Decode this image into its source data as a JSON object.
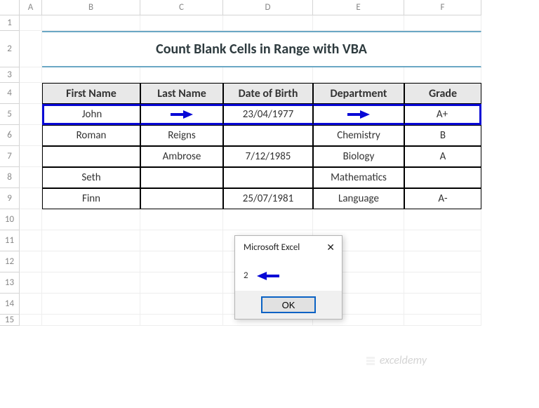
{
  "columns": [
    "A",
    "B",
    "C",
    "D",
    "E",
    "F"
  ],
  "rows": [
    "1",
    "2",
    "3",
    "4",
    "5",
    "6",
    "7",
    "8",
    "9",
    "10",
    "11",
    "12",
    "13",
    "14",
    "15"
  ],
  "title": "Count Blank Cells in Range with VBA",
  "headers": {
    "b": "First Name",
    "c": "Last Name",
    "d": "Date of Birth",
    "e": "Department",
    "f": "Grade"
  },
  "row5": {
    "b": "John",
    "c": "",
    "d": "23/04/1977",
    "e": "",
    "f": "A+"
  },
  "row6": {
    "b": "Roman",
    "c": "Reigns",
    "d": "",
    "e": "Chemistry",
    "f": "B"
  },
  "row7": {
    "b": "",
    "c": "Ambrose",
    "d": "7/12/1985",
    "e": "Biology",
    "f": "A"
  },
  "row8": {
    "b": "Seth",
    "c": "",
    "d": "",
    "e": "Mathematics",
    "f": ""
  },
  "row9": {
    "b": "Finn",
    "c": "",
    "d": "25/07/1981",
    "e": "Language",
    "f": "A-"
  },
  "dialog": {
    "title": "Microsoft Excel",
    "message": "2",
    "ok": "OK"
  },
  "watermark": "exceldemy",
  "chart_data": {
    "type": "table",
    "title": "Count Blank Cells in Range with VBA",
    "categories": [
      "First Name",
      "Last Name",
      "Date of Birth",
      "Department",
      "Grade"
    ],
    "series": [
      {
        "name": "Row5",
        "values": [
          "John",
          "",
          "23/04/1977",
          "",
          "A+"
        ]
      },
      {
        "name": "Row6",
        "values": [
          "Roman",
          "Reigns",
          "",
          "Chemistry",
          "B"
        ]
      },
      {
        "name": "Row7",
        "values": [
          "",
          "Ambrose",
          "7/12/1985",
          "Biology",
          "A"
        ]
      },
      {
        "name": "Row8",
        "values": [
          "Seth",
          "",
          "",
          "Mathematics",
          ""
        ]
      },
      {
        "name": "Row9",
        "values": [
          "Finn",
          "",
          "25/07/1981",
          "Language",
          "A-"
        ]
      }
    ],
    "blank_count_row5": 2
  }
}
